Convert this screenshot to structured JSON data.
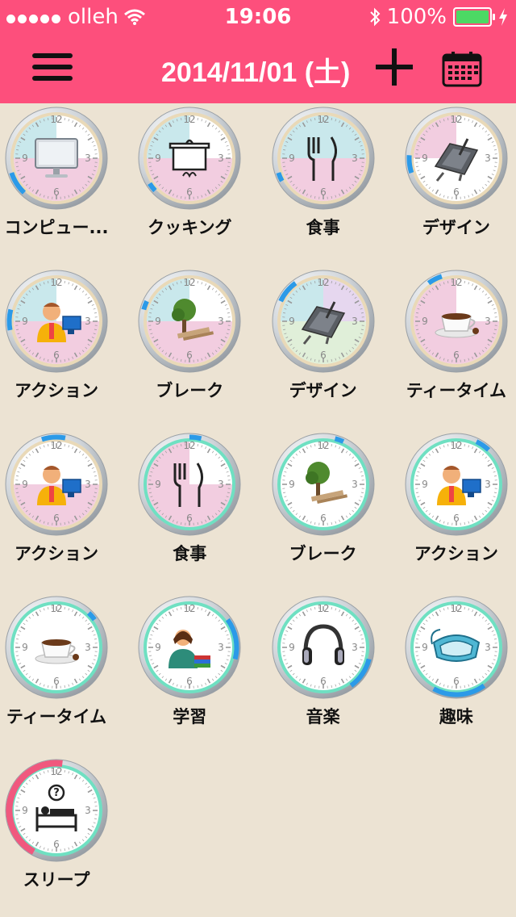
{
  "status": {
    "carrier": "olleh",
    "time": "19:06",
    "battery": "100%"
  },
  "header": {
    "date": "2014/11/01 (土)"
  },
  "clock_numerals": [
    "12",
    "3",
    "6",
    "9"
  ],
  "activities": [
    {
      "label": "コンピュー...",
      "icon": "computer-monitor-icon",
      "ring": "silver",
      "quadrants": [
        "#ffffff",
        "#ffffff",
        "#f2cde0",
        "#c9e8ec"
      ],
      "progress": [
        0.62,
        0.7
      ],
      "accent": "#2b9ae8"
    },
    {
      "label": "クッキング",
      "icon": "cooking-pot-icon",
      "ring": "silver",
      "quadrants": [
        "#ffffff",
        "#ffffff",
        "#f2cde0",
        "#c9e8ec"
      ],
      "progress": [
        0.63,
        0.66
      ],
      "accent": "#2b9ae8"
    },
    {
      "label": "食事",
      "icon": "fork-knife-icon",
      "ring": "silver",
      "quadrants": [
        "#c9e8ec",
        "#c9e8ec",
        "#f2cde0",
        "#c9e8ec"
      ],
      "progress": [
        0.67,
        0.7
      ],
      "accent": "#2b9ae8"
    },
    {
      "label": "デザイン",
      "icon": "drawing-tablet-icon",
      "ring": "silver",
      "quadrants": [
        "#ffffff",
        "#ffffff",
        "#ffffff",
        "#f2cde0"
      ],
      "progress": [
        0.7,
        0.76
      ],
      "accent": "#2b9ae8"
    },
    {
      "label": "アクション",
      "icon": "office-worker-icon",
      "ring": "silver",
      "quadrants": [
        "#ffffff",
        "#ffffff",
        "#f2cde0",
        "#c9e8ec"
      ],
      "progress": [
        0.72,
        0.79
      ],
      "accent": "#2b9ae8"
    },
    {
      "label": "ブレーク",
      "icon": "park-bench-icon",
      "ring": "silver",
      "quadrants": [
        "#ffffff",
        "#ffffff",
        "#f2cde0",
        "#c9e8ec"
      ],
      "progress": [
        0.79,
        0.82
      ],
      "accent": "#2b9ae8"
    },
    {
      "label": "デザイン",
      "icon": "drawing-tablet-icon",
      "ring": "silver",
      "quadrants": [
        "#e6d7ef",
        "#e6d7ef",
        "#e0efd9",
        "#c9e8ec"
      ],
      "progress": [
        0.82,
        0.9
      ],
      "accent": "#2b9ae8"
    },
    {
      "label": "ティータイム",
      "icon": "tea-cup-icon",
      "ring": "silver",
      "quadrants": [
        "#ffffff",
        "#ffffff",
        "#f2cde0",
        "#f2cde0"
      ],
      "progress": [
        0.9,
        0.95
      ],
      "accent": "#2b9ae8"
    },
    {
      "label": "アクション",
      "icon": "office-worker-icon",
      "ring": "silver",
      "quadrants": [
        "#ffffff",
        "#ffffff",
        "#f2cde0",
        "#ffffff"
      ],
      "progress": [
        0.95,
        0.03
      ],
      "accent": "#2b9ae8"
    },
    {
      "label": "食事",
      "icon": "fork-knife-icon",
      "ring": "teal",
      "quadrants": [
        "#ffffff",
        "#ffffff",
        "#f2cde0",
        "#f2cde0"
      ],
      "progress": [
        0.0,
        0.04
      ],
      "accent": "#2b9ae8"
    },
    {
      "label": "ブレーク",
      "icon": "park-bench-icon",
      "ring": "teal",
      "quadrants": [
        "#ffffff",
        "#ffffff",
        "#ffffff",
        "#ffffff"
      ],
      "progress": [
        0.04,
        0.07
      ],
      "accent": "#2b9ae8"
    },
    {
      "label": "アクション",
      "icon": "office-worker-icon",
      "ring": "teal",
      "quadrants": [
        "#ffffff",
        "#ffffff",
        "#ffffff",
        "#ffffff"
      ],
      "progress": [
        0.07,
        0.12
      ],
      "accent": "#2b9ae8"
    },
    {
      "label": "ティータイム",
      "icon": "tea-cup-icon",
      "ring": "teal",
      "quadrants": [
        "#ffffff",
        "#ffffff",
        "#ffffff",
        "#ffffff"
      ],
      "progress": [
        0.12,
        0.15
      ],
      "accent": "#2b9ae8"
    },
    {
      "label": "学習",
      "icon": "student-books-icon",
      "ring": "teal",
      "quadrants": [
        "#ffffff",
        "#ffffff",
        "#ffffff",
        "#ffffff"
      ],
      "progress": [
        0.15,
        0.29
      ],
      "accent": "#2b9ae8"
    },
    {
      "label": "音楽",
      "icon": "headphones-icon",
      "ring": "teal",
      "quadrants": [
        "#ffffff",
        "#ffffff",
        "#ffffff",
        "#ffffff"
      ],
      "progress": [
        0.29,
        0.4
      ],
      "accent": "#2b9ae8"
    },
    {
      "label": "趣味",
      "icon": "diving-mask-icon",
      "ring": "teal",
      "quadrants": [
        "#e6d7ef",
        "#ffffff",
        "#ffffff",
        "#ffffff"
      ],
      "progress": [
        0.4,
        0.58
      ],
      "accent": "#2b9ae8"
    },
    {
      "label": "スリープ",
      "icon": "sleep-bed-icon",
      "ring": "teal",
      "quadrants": [
        "#ffffff",
        "#ffffff",
        "#ffffff",
        "#ffffff"
      ],
      "progress": [
        0.58,
        0.02
      ],
      "accent": "#f0587e"
    }
  ]
}
